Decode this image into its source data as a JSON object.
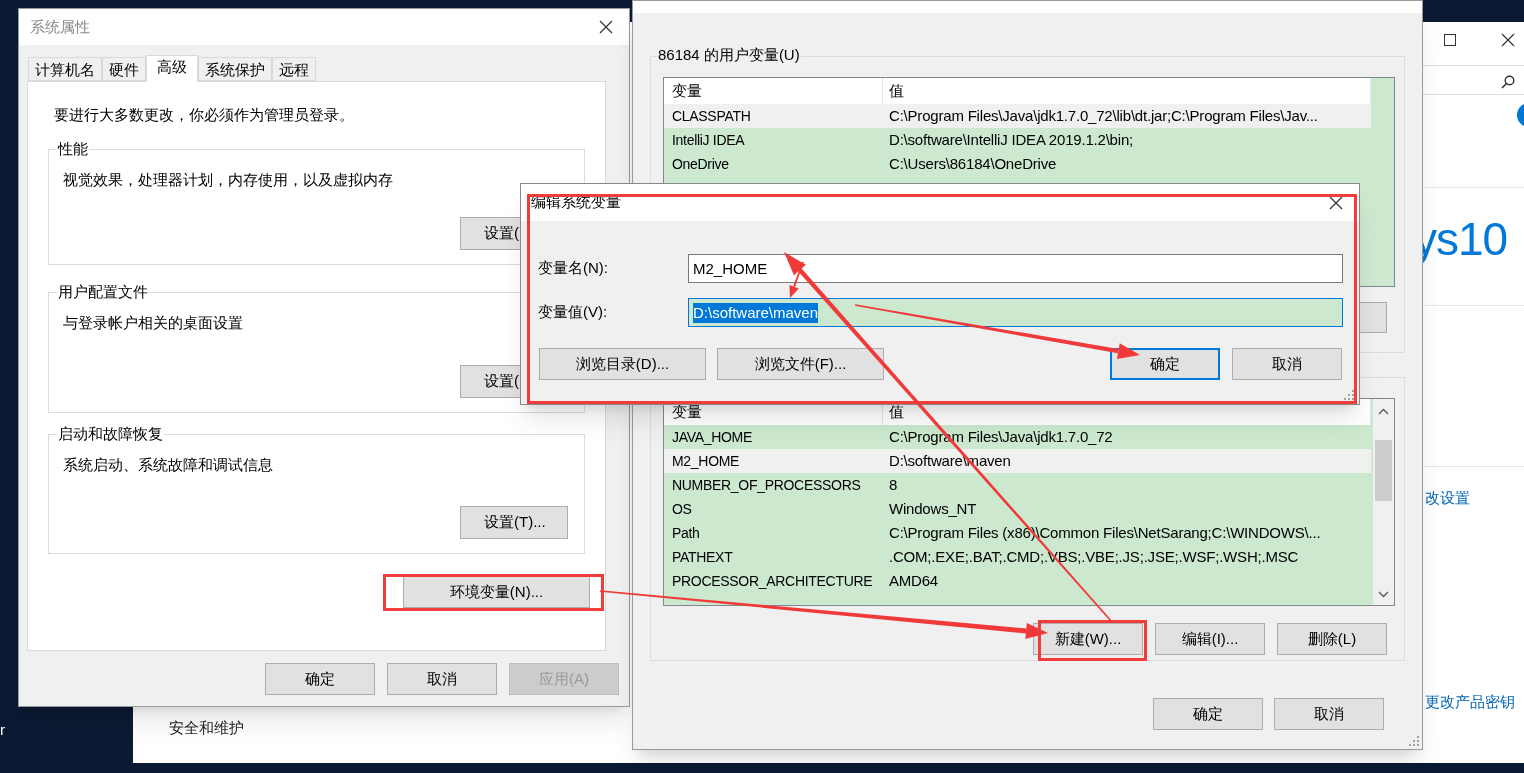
{
  "desktop": {
    "icon_label": "r"
  },
  "background_window": {
    "brand_fragment": "ys10",
    "links": [
      "改设置",
      "更改产品密钥"
    ],
    "item": "安全和维护"
  },
  "system_properties": {
    "title": "系统属性",
    "tabs": [
      {
        "label": "计算机名",
        "selected": false
      },
      {
        "label": "硬件",
        "selected": false
      },
      {
        "label": "高级",
        "selected": true
      },
      {
        "label": "系统保护",
        "selected": false
      },
      {
        "label": "远程",
        "selected": false
      }
    ],
    "notice": "要进行大多数更改，你必须作为管理员登录。",
    "groups": [
      {
        "title": "性能",
        "description": "视觉效果，处理器计划，内存使用，以及虚拟内存",
        "button": "设置("
      },
      {
        "title": "用户配置文件",
        "description": "与登录帐户相关的桌面设置",
        "button": "设置("
      },
      {
        "title": "启动和故障恢复",
        "description": "系统启动、系统故障和调试信息",
        "button": "设置(T)..."
      }
    ],
    "env_button": "环境变量(N)...",
    "buttons": [
      {
        "label": "确定",
        "disabled": false
      },
      {
        "label": "取消",
        "disabled": false
      },
      {
        "label": "应用(A)",
        "disabled": true
      }
    ]
  },
  "environment_variables": {
    "user_group": {
      "title": "86184 的用户变量(U)",
      "columns": [
        "变量",
        "值"
      ],
      "rows": [
        {
          "name": "CLASSPATH",
          "value": "C:\\Program Files\\Java\\jdk1.7.0_72\\lib\\dt.jar;C:\\Program Files\\Jav...",
          "selected": true
        },
        {
          "name": "IntelliJ IDEA",
          "value": "D:\\software\\IntelliJ IDEA 2019.1.2\\bin;",
          "selected": false
        },
        {
          "name": "OneDrive",
          "value": "C:\\Users\\86184\\OneDrive",
          "selected": false
        }
      ]
    },
    "system_group": {
      "columns": [
        "变量",
        "值"
      ],
      "rows": [
        {
          "name": "JAVA_HOME",
          "value": "C:\\Program Files\\Java\\jdk1.7.0_72",
          "selected": false
        },
        {
          "name": "M2_HOME",
          "value": "D:\\software\\maven",
          "selected": true
        },
        {
          "name": "NUMBER_OF_PROCESSORS",
          "value": "8",
          "selected": false
        },
        {
          "name": "OS",
          "value": "Windows_NT",
          "selected": false
        },
        {
          "name": "Path",
          "value": "C:\\Program Files (x86)\\Common Files\\NetSarang;C:\\WINDOWS\\...",
          "selected": false
        },
        {
          "name": "PATHEXT",
          "value": ".COM;.EXE;.BAT;.CMD;.VBS;.VBE;.JS;.JSE;.WSF;.WSH;.MSC",
          "selected": false
        },
        {
          "name": "PROCESSOR_ARCHITECTURE",
          "value": "AMD64",
          "selected": false
        }
      ],
      "buttons": [
        "新建(W)...",
        "编辑(I)...",
        "删除(L)"
      ]
    },
    "buttons": [
      "确定",
      "取消"
    ]
  },
  "edit_dialog": {
    "title": "编辑系统变量",
    "fields": [
      {
        "label": "变量名(N):",
        "value": "M2_HOME",
        "text_selected": false
      },
      {
        "label": "变量值(V):",
        "value": "D:\\software\\maven",
        "text_selected": true
      }
    ],
    "buttons": [
      {
        "label": "浏览目录(D)...",
        "default": false
      },
      {
        "label": "浏览文件(F)...",
        "default": false
      },
      {
        "label": "确定",
        "default": true
      },
      {
        "label": "取消",
        "default": false
      }
    ]
  }
}
